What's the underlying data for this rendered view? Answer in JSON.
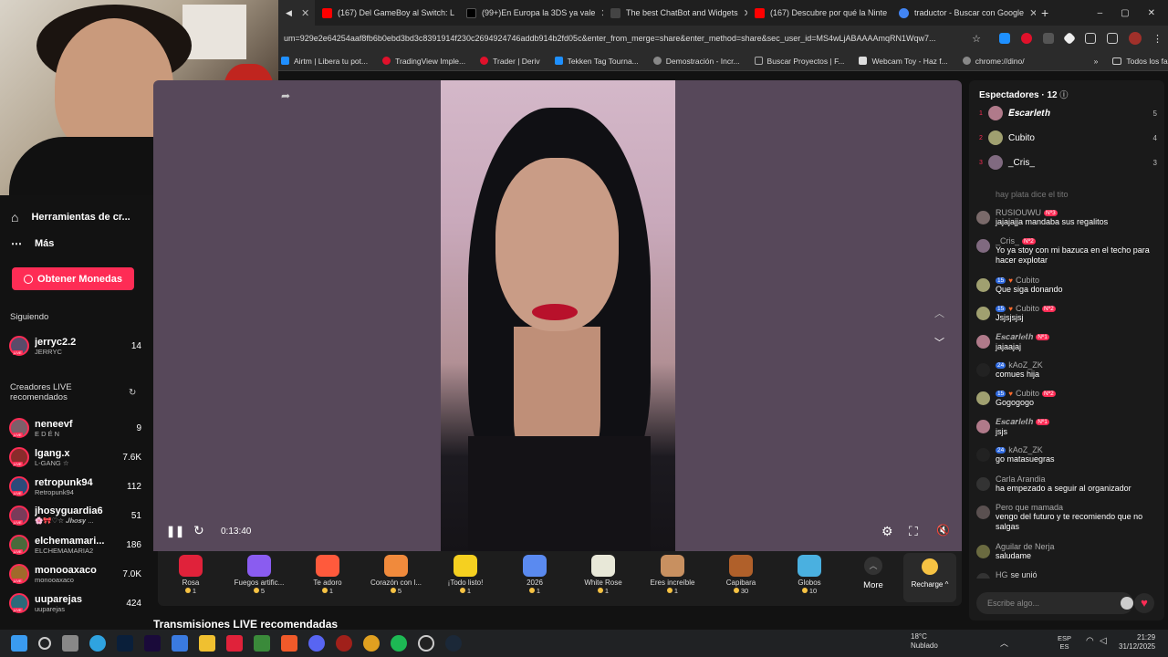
{
  "tabs": [
    {
      "title": "",
      "color": "#7a7a7a",
      "active": true
    },
    {
      "title": "(167) Del GameBoy al Switch: L",
      "color": "#ff0000",
      "active": false
    },
    {
      "title": "(99+)En Europa la 3DS ya vale",
      "color": "#000000",
      "active": false
    },
    {
      "title": "The best ChatBot and Widgets",
      "color": "#444444",
      "active": false
    },
    {
      "title": "(167) Descubre por qué la Ninte",
      "color": "#ff0000",
      "active": false
    },
    {
      "title": "traductor - Buscar con Google",
      "color": "#4285f4",
      "active": false
    }
  ],
  "new_tab_label": "+",
  "window_controls": [
    "–",
    "▢",
    "✕"
  ],
  "address": {
    "url": "um=929e2e64254aaf8fb6b0ebd3bd3c8391914f230c2694924746addb914b2fd05c&enter_from_merge=share&enter_method=share&sec_user_id=MS4wLjABAAAAmqRN1Wqw7..."
  },
  "bookmarks": [
    {
      "label": "Airtm | Libera tu pot...",
      "color": "#1f8fff"
    },
    {
      "label": "TradingView Imple...",
      "color": "#e0112b"
    },
    {
      "label": "Trader | Deriv",
      "color": "#e0112b"
    },
    {
      "label": "Tekken Tag Tourna...",
      "color": "#1e90ff"
    },
    {
      "label": "Demostración - Incr...",
      "color": "#888888"
    },
    {
      "label": "Buscar Proyectos | F...",
      "color": "#888888"
    },
    {
      "label": "Webcam Toy - Haz f...",
      "color": "#dddddd"
    },
    {
      "label": "chrome://dino/",
      "color": "#888888"
    }
  ],
  "bookmarks_more": "»",
  "bookmarks_all": "Todos los favoritos",
  "leftnav": {
    "tools_label": "Herramientas de cr...",
    "more_label": "Más",
    "coins_button": "Obtener Monedas",
    "following_title": "Siguiendo",
    "following": [
      {
        "name": "jerryc2.2",
        "sub": "JERRYC",
        "count": "14",
        "color": "#5a4b6a"
      }
    ],
    "recommended_title_1": "Creadores LIVE",
    "recommended_title_2": "recomendados",
    "recommended": [
      {
        "name": "neneevf",
        "sub": "E D É N",
        "count": "9",
        "color": "#7d5f6a"
      },
      {
        "name": "lgang.x",
        "sub": "L-GANG ☆",
        "count": "7.6K",
        "color": "#8a2b2b"
      },
      {
        "name": "retropunk94",
        "sub": "Retropunk94",
        "count": "112",
        "color": "#2b4a7a"
      },
      {
        "name": "jhosyguardia6",
        "sub": "🌸🎀♡☆ 𝑱𝒉𝒐𝒔𝒚 ...",
        "count": "51",
        "color": "#7a3b5a"
      },
      {
        "name": "elchemamari...",
        "sub": "ELCHEMAMARIA2",
        "count": "186",
        "color": "#4a6a3b"
      },
      {
        "name": "monooaxaco",
        "sub": "monooaxaco",
        "count": "7.0K",
        "color": "#a06a2b"
      },
      {
        "name": "uuparejas",
        "sub": "uuparejas",
        "count": "424",
        "color": "#2b6a7a"
      }
    ]
  },
  "player": {
    "timecode": "0:13:40"
  },
  "gifts": [
    {
      "name": "Rosa",
      "price": "1",
      "color": "#e0223a"
    },
    {
      "name": "Fuegos artific...",
      "price": "5",
      "color": "#8a5cf0"
    },
    {
      "name": "Te adoro",
      "price": "1",
      "color": "#ff5a3c"
    },
    {
      "name": "Corazón con l...",
      "price": "5",
      "color": "#f08a3c"
    },
    {
      "name": "¡Todo listo!",
      "price": "1",
      "color": "#f5d020"
    },
    {
      "name": "2026",
      "price": "1",
      "color": "#5a8af0"
    },
    {
      "name": "White Rose",
      "price": "1",
      "color": "#e8e8d8"
    },
    {
      "name": "Eres increíble",
      "price": "1",
      "color": "#c89060"
    },
    {
      "name": "Capibara",
      "price": "30",
      "color": "#b0602a"
    },
    {
      "name": "Globos",
      "price": "10",
      "color": "#4ab0e0"
    }
  ],
  "gift_more": "More",
  "recharge": "Recharge",
  "recommended_streams_title": "Transmisiones LIVE recomendadas",
  "viewers": {
    "title": "Espectadores · 12",
    "list": [
      {
        "rank": "1",
        "name": "𝑬𝒔𝒄𝒂𝒓𝒍𝒆𝒕𝒉",
        "score": "5",
        "color": "#b07a8a"
      },
      {
        "rank": "2",
        "name": "Cubito",
        "score": "4",
        "color": "#a0a070"
      },
      {
        "rank": "3",
        "name": "_Cris_",
        "score": "3",
        "color": "#806a80"
      }
    ]
  },
  "chat": [
    {
      "user": "hay plata dice el tito",
      "lvl": "",
      "fan": "",
      "mod": false,
      "text": "",
      "color": "#1a1a1a"
    },
    {
      "user": "RUSIOUWU",
      "lvl": "",
      "fan": "Nº3",
      "mod": false,
      "text": "jajajajja mandaba sus regalitos",
      "color": "#7a6a6a"
    },
    {
      "user": "_Cris_",
      "lvl": "",
      "fan": "Nº2",
      "mod": false,
      "text": "Yo ya stoy con mi bazuca en el techo para hacer explotar",
      "color": "#806a80"
    },
    {
      "user": "Cubito",
      "lvl": "15",
      "fan": "",
      "mod": true,
      "text": "Que siga donando",
      "color": "#a0a070"
    },
    {
      "user": "Cubito",
      "lvl": "15",
      "fan": "Nº2",
      "mod": true,
      "text": "Jsjsjsjsj",
      "color": "#a0a070"
    },
    {
      "user": "𝑬𝒔𝒄𝒂𝒓𝒍𝒆𝒕𝒉",
      "lvl": "",
      "fan": "Nº1",
      "mod": false,
      "text": "jajaajaj",
      "color": "#b07a8a"
    },
    {
      "user": "kAoZ_ZK",
      "lvl": "24",
      "fan": "",
      "mod": false,
      "text": "comues hija",
      "color": "#222222"
    },
    {
      "user": "Cubito",
      "lvl": "15",
      "fan": "Nº2",
      "mod": true,
      "text": "Gogogogo",
      "color": "#a0a070"
    },
    {
      "user": "𝑬𝒔𝒄𝒂𝒓𝒍𝒆𝒕𝒉",
      "lvl": "",
      "fan": "Nº1",
      "mod": false,
      "text": "jsjs",
      "color": "#b07a8a"
    },
    {
      "user": "kAoZ_ZK",
      "lvl": "24",
      "fan": "",
      "mod": false,
      "text": "go matasuegras",
      "color": "#222222"
    },
    {
      "user": "Carla Arandia",
      "lvl": "",
      "fan": "",
      "mod": false,
      "text": "ha empezado a seguir al organizador",
      "color": "#333333"
    },
    {
      "user": "Pero que mamada",
      "lvl": "",
      "fan": "",
      "mod": false,
      "text": "vengo del futuro y te recomiendo que no salgas",
      "color": "#5a5050"
    },
    {
      "user": "Aguilar de Nerja",
      "lvl": "",
      "fan": "",
      "mod": false,
      "text": "saludame",
      "color": "#6a6a40"
    },
    {
      "user": "HG",
      "lvl": "",
      "fan": "",
      "mod": false,
      "text": "se unió",
      "color": "#333333"
    }
  ],
  "chat_placeholder": "Escribe algo...",
  "taskbar": {
    "weather_temp": "18°C",
    "weather_desc": "Nublado",
    "lang_1": "ESP",
    "lang_2": "ES",
    "time": "21:29",
    "date": "31/12/2025"
  }
}
